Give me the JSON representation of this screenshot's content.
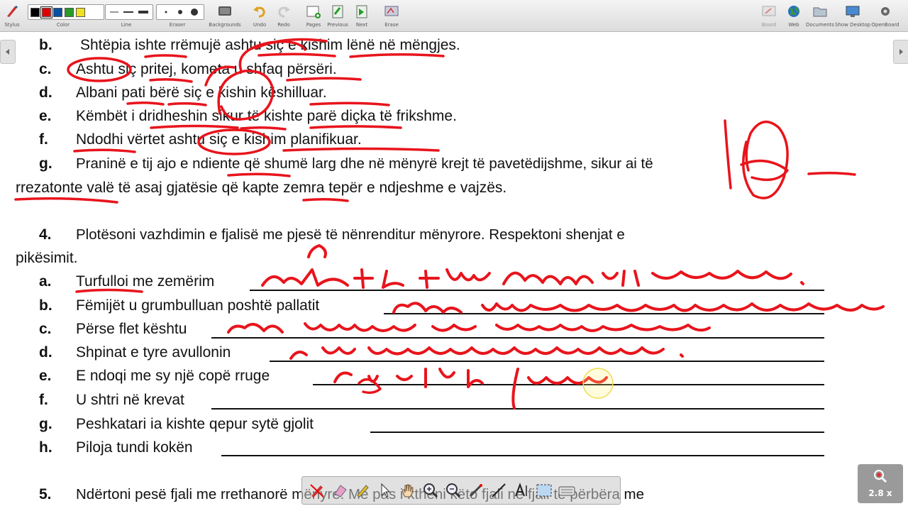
{
  "toolbar": {
    "stylus_label": "Stylus",
    "color_label": "Color",
    "line_label": "Line",
    "eraser_label": "Eraser",
    "backgrounds_label": "Backgrounds",
    "undo_label": "Undo",
    "redo_label": "Redo",
    "pages_label": "Pages",
    "previous_label": "Previous",
    "next_label": "Next",
    "erase_label": "Erase",
    "board_label": "Board",
    "web_label": "Web",
    "documents_label": "Documents",
    "show_desktop_label": "Show Desktop",
    "openboard_label": "OpenBoard",
    "colors": [
      "#000000",
      "#e00000",
      "#0a4fa0",
      "#2a9a2a",
      "#f0e020"
    ],
    "selected_color": "#e00000"
  },
  "document": {
    "items_top": [
      {
        "letter": "b.",
        "text": "Shtëpia ishte rrëmujë ashtu siç e kishim lënë në mëngjes."
      },
      {
        "letter": "c.",
        "text": "Ashtu siç pritej, kometa u shfaq përsëri."
      },
      {
        "letter": "d.",
        "text": "Albani pati bërë siç e kishin këshilluar."
      },
      {
        "letter": "e.",
        "text": "Këmbët i dridheshin sikur të kishte parë diçka të frikshme."
      },
      {
        "letter": "f.",
        "text": "Ndodhi vërtet ashtu siç e kishim planifikuar."
      },
      {
        "letter": "g.",
        "text": "Praninë e tij ajo e ndiente që shumë larg dhe në mënyrë krejt të pavetëdijshme, sikur ai të"
      }
    ],
    "item_g_cont": "rrezatonte valë të asaj gjatësie që kapte zemra tepër e ndjeshme e vajzës.",
    "task4_number": "4.",
    "task4_text": "Plotësoni vazhdimin e fjalisë me pjesë të nënrenditur mënyrore. Respektoni shenjat e",
    "task4_cont": "pikësimit.",
    "items4": [
      {
        "letter": "a.",
        "text": "Turfulloi me zemërim"
      },
      {
        "letter": "b.",
        "text": "Fëmijët u grumbulluan poshtë pallatit"
      },
      {
        "letter": "c.",
        "text": "Përse flet kështu"
      },
      {
        "letter": "d.",
        "text": "Shpinat e tyre avullonin"
      },
      {
        "letter": "e.",
        "text": "E ndoqi me sy një copë rruge"
      },
      {
        "letter": "f.",
        "text": "U shtri në krevat"
      },
      {
        "letter": "g.",
        "text": "Peshkatari ia kishte qepur sytë gjolit"
      },
      {
        "letter": "h.",
        "text": "Piloja tundi kokën"
      }
    ],
    "task5_number": "5.",
    "task5_text": "Ndërtoni pesë fjali me rrethanorë mënyre. Më pas i ktheni këto fjali në fjali të përbëra me"
  },
  "annotations": {
    "score_mark": "10",
    "ink_color": "#e8141c"
  },
  "zoom": {
    "level": "2.8 x"
  }
}
